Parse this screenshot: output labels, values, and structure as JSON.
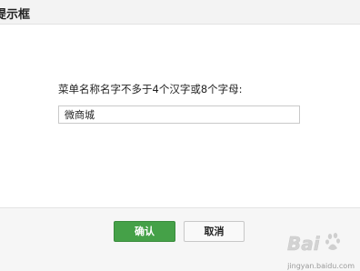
{
  "dialog": {
    "title": "提示框",
    "prompt": "菜单名称名字不多于4个汉字或8个字母:",
    "input_value": "微商城",
    "confirm_label": "确认",
    "cancel_label": "取消"
  },
  "watermark": {
    "brand": "Baidu",
    "sub": "jingyan.baidu.com"
  },
  "colors": {
    "confirm_bg": "#45a148",
    "header_bg": "#f3f3f3",
    "footer_bg": "#f6f6f6"
  }
}
